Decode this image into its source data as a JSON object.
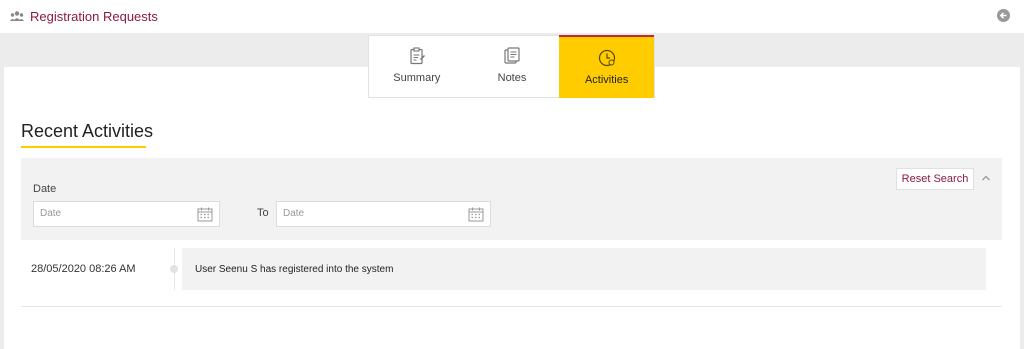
{
  "header": {
    "title": "Registration Requests",
    "icon": "users-icon",
    "back_icon": "back-arrow-icon"
  },
  "tabs": [
    {
      "label": "Summary",
      "icon": "clipboard-icon",
      "active": false
    },
    {
      "label": "Notes",
      "icon": "notes-icon",
      "active": false
    },
    {
      "label": "Activities",
      "icon": "clock-icon",
      "active": true
    }
  ],
  "section": {
    "title": "Recent Activities"
  },
  "filter": {
    "date_label": "Date",
    "from_placeholder": "Date",
    "to_label": "To",
    "to_placeholder": "Date",
    "reset_label": "Reset Search"
  },
  "activities": [
    {
      "timestamp": "28/05/2020 08:26 AM",
      "message": "User Seenu S has registered into the system"
    }
  ],
  "colors": {
    "accent": "#ffcc00",
    "brand": "#8b1c3c",
    "background": "#ececec"
  }
}
